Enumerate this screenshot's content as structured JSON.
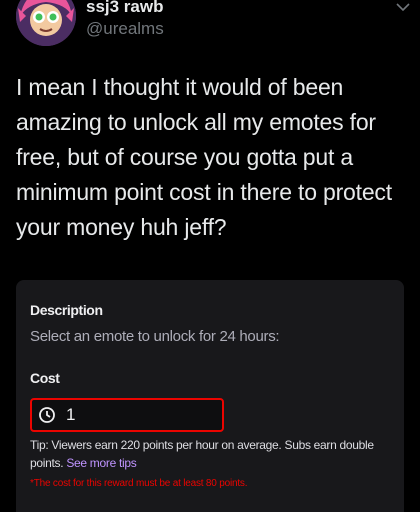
{
  "tweet": {
    "display_name": "ssj3 rawb",
    "username": "@urealms",
    "text": "I mean I thought it would of been amazing to unlock all my emotes for free, but of course you gotta put a minimum point cost in there to protect your money huh jeff?"
  },
  "card": {
    "description_label": "Description",
    "description_text": "Select an emote to unlock for 24 hours:",
    "cost_label": "Cost",
    "cost_value": "1",
    "tip_text": "Tip: Viewers earn 220 points per hour on average. Subs earn double points.",
    "tip_link": "See more tips",
    "error_text": "*The cost for this reward must be at least 80 points."
  },
  "icons": {
    "more": "chevron-down-icon",
    "cost": "channel-points-icon"
  },
  "colors": {
    "background": "#000000",
    "card": "#18181b",
    "error": "#eb0400",
    "link": "#bf94ff"
  }
}
